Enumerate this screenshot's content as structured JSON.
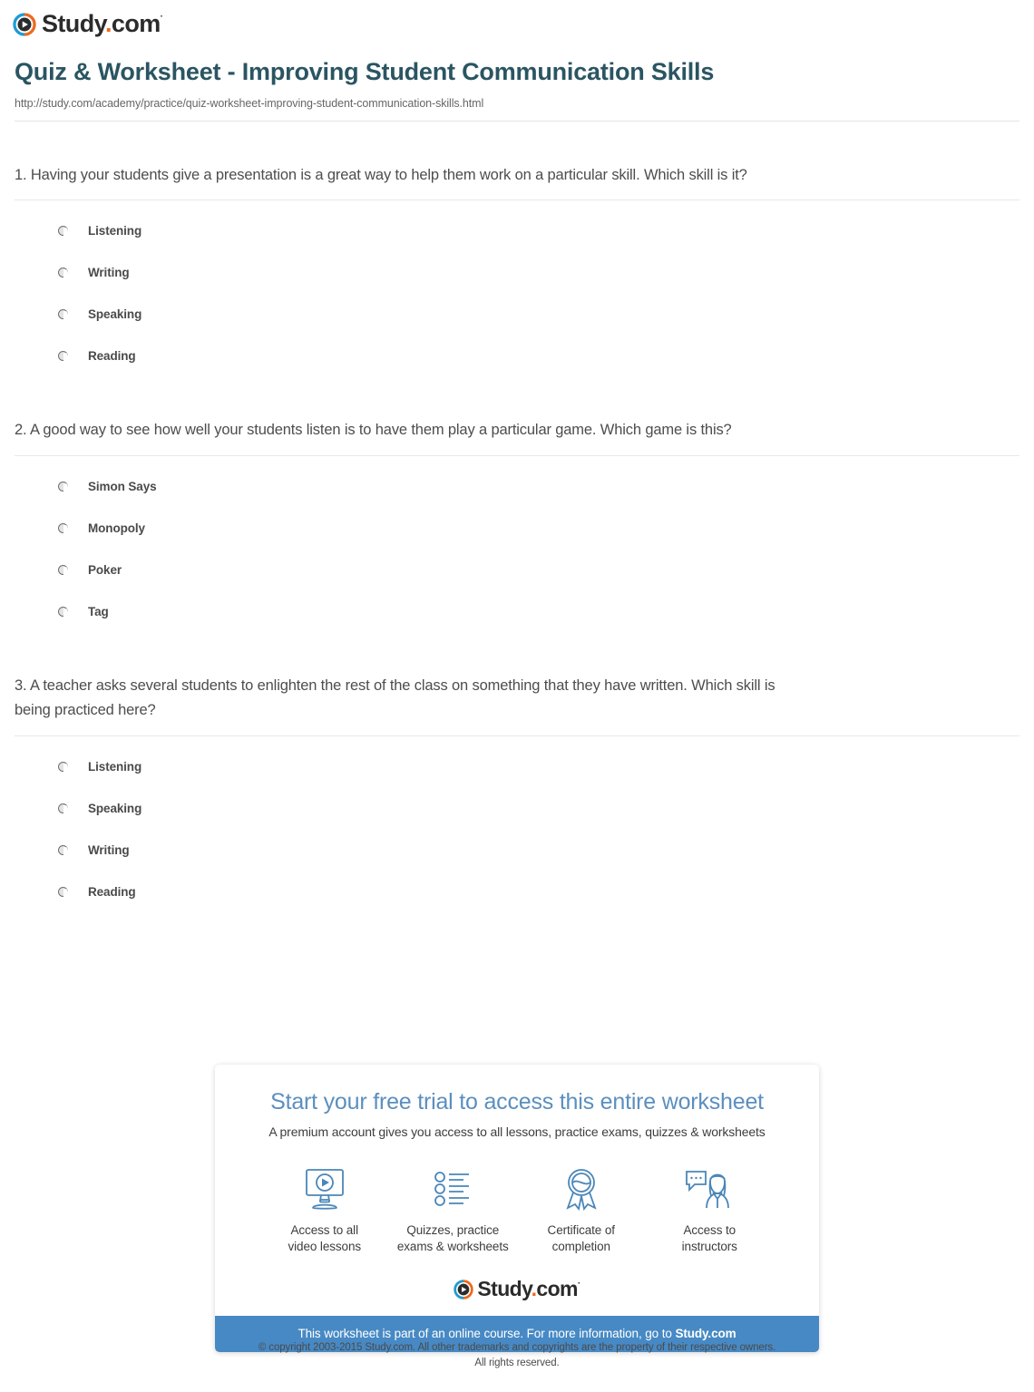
{
  "brand": {
    "name_main": "Study",
    "name_dot": ".",
    "name_tld": "com",
    "tm": "·",
    "logo_icon": "play-circle-icon",
    "accent_orange": "#ec6a1e",
    "accent_blue": "#1f9bd1",
    "bar_blue": "#4789c4",
    "headline_blue": "#5b8fbf",
    "title_teal": "#2a5562"
  },
  "header": {
    "title": "Quiz & Worksheet - Improving Student Communication Skills",
    "url": "http://study.com/academy/practice/quiz-worksheet-improving-student-communication-skills.html"
  },
  "questions": [
    {
      "text": "1. Having your students give a presentation is a great way to help them work on a particular skill. Which skill is it?",
      "options": [
        "Listening",
        "Writing",
        "Speaking",
        "Reading"
      ]
    },
    {
      "text": "2. A good way to see how well your students listen is to have them play a particular game. Which game is this?",
      "options": [
        "Simon Says",
        "Monopoly",
        "Poker",
        "Tag"
      ]
    },
    {
      "text": "3. A teacher asks several students to enlighten the rest of the class on something that they have written. Which skill is being practiced here?",
      "options": [
        "Listening",
        "Speaking",
        "Writing",
        "Reading"
      ]
    }
  ],
  "promo": {
    "headline": "Start your free trial to access this entire worksheet",
    "subhead": "A premium account gives you access to all lessons, practice exams, quizzes & worksheets",
    "features": [
      {
        "icon": "monitor-play-icon",
        "line1": "Access to all",
        "line2": "video lessons"
      },
      {
        "icon": "checklist-icon",
        "line1": "Quizzes, practice",
        "line2": "exams & worksheets"
      },
      {
        "icon": "award-ribbon-icon",
        "line1": "Certificate of",
        "line2": "completion"
      },
      {
        "icon": "instructor-chat-icon",
        "line1": "Access to",
        "line2": "instructors"
      }
    ],
    "bar_text": "This worksheet is part of an online course. For more information, go to ",
    "bar_link": "Study.com"
  },
  "footer": {
    "copyright_line1": "© copyright 2003-2015 Study.com. All other trademarks and copyrights are the property of their respective owners.",
    "copyright_line2": "All rights reserved."
  }
}
